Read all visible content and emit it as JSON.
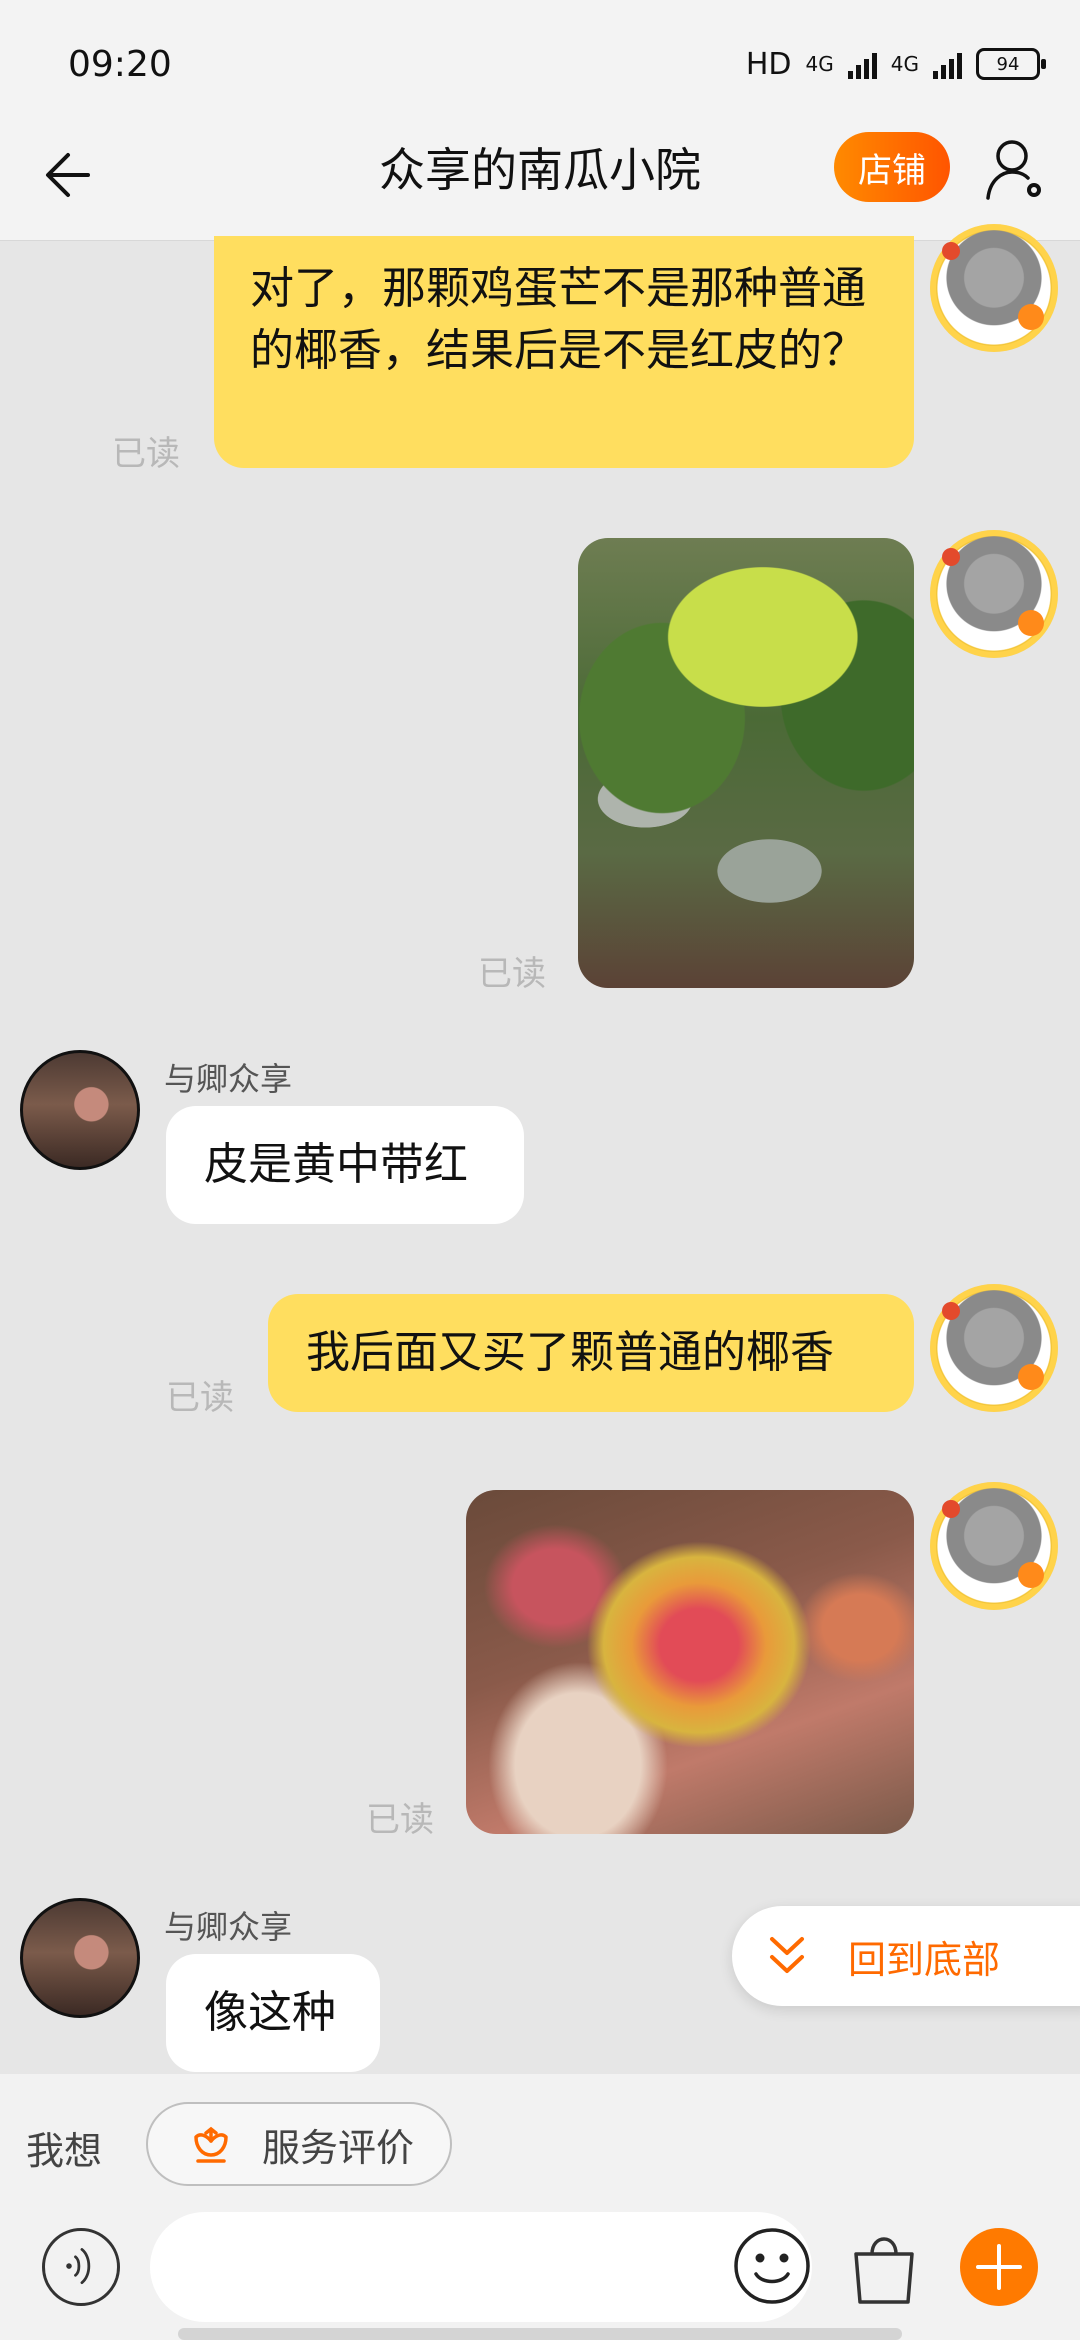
{
  "status_bar": {
    "time": "09:20",
    "network_label": "HD",
    "sim1_label": "4G",
    "sim2_label": "4G",
    "battery": "94"
  },
  "header": {
    "title": "众享的南瓜小院",
    "shop_button": "店铺"
  },
  "messages": {
    "m1": {
      "text": "对了，那颗鸡蛋芒不是那种普通的椰香，结果后是不是红皮的？",
      "status": "已读"
    },
    "m2": {
      "status": "已读"
    },
    "m3": {
      "sender": "与卿众享",
      "text": "皮是黄中带红"
    },
    "m4": {
      "text": "我后面又买了颗普通的椰香",
      "status": "已读"
    },
    "m5": {
      "status": "已读"
    },
    "m6": {
      "sender": "与卿众享",
      "text": "像这种"
    }
  },
  "back_to_bottom": "回到底部",
  "suggest_bar": {
    "prefix": "我想",
    "chip_label": "服务评价"
  },
  "input_bar": {
    "value": "",
    "placeholder": ""
  },
  "colors": {
    "accent": "#ff6a00",
    "my_bubble": "#ffde5f",
    "background": "#e6e6e6"
  },
  "icons": [
    "back-arrow-icon",
    "user-settings-icon",
    "chevron-double-down-icon",
    "flower-icon",
    "voice-icon",
    "emoji-icon",
    "shopping-bag-icon",
    "plus-icon"
  ]
}
